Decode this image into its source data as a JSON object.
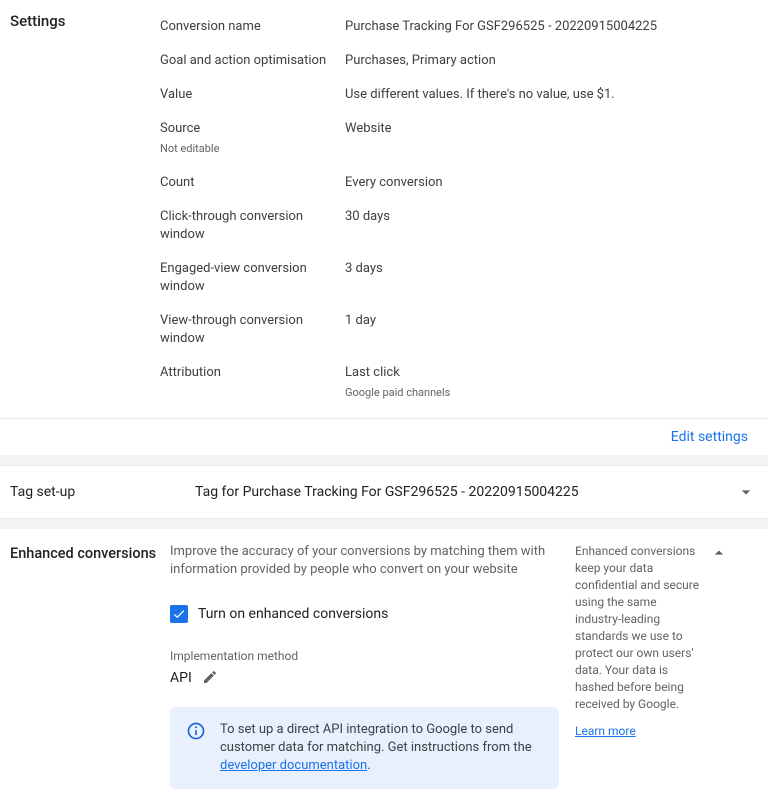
{
  "settings": {
    "heading": "Settings",
    "rows": [
      {
        "label": "Conversion name",
        "sublabel": "",
        "value": "Purchase Tracking For GSF296525 - 20220915004225",
        "subvalue": ""
      },
      {
        "label": "Goal and action optimisation",
        "sublabel": "",
        "value": "Purchases, Primary action",
        "subvalue": ""
      },
      {
        "label": "Value",
        "sublabel": "",
        "value": "Use different values. If there's no value, use $1.",
        "subvalue": ""
      },
      {
        "label": "Source",
        "sublabel": "Not editable",
        "value": "Website",
        "subvalue": ""
      },
      {
        "label": "Count",
        "sublabel": "",
        "value": "Every conversion",
        "subvalue": ""
      },
      {
        "label": "Click-through conversion window",
        "sublabel": "",
        "value": "30 days",
        "subvalue": ""
      },
      {
        "label": "Engaged-view conversion window",
        "sublabel": "",
        "value": "3 days",
        "subvalue": ""
      },
      {
        "label": "View-through conversion window",
        "sublabel": "",
        "value": "1 day",
        "subvalue": ""
      },
      {
        "label": "Attribution",
        "sublabel": "",
        "value": "Last click",
        "subvalue": "Google paid channels"
      }
    ],
    "edit_label": "Edit settings"
  },
  "tag": {
    "heading": "Tag set-up",
    "title": "Tag for Purchase Tracking For GSF296525 - 20220915004225"
  },
  "enhanced": {
    "heading": "Enhanced conversions",
    "description": "Improve the accuracy of your conversions by matching them with information provided by people who convert on your website",
    "checkbox_label": "Turn on enhanced conversions",
    "impl_label": "Implementation method",
    "impl_value": "API",
    "info_text_pre": "To set up a direct API integration to Google to send customer data for matching. Get instructions from the ",
    "info_link": "developer documentation",
    "info_text_post": ".",
    "side_text": "Enhanced conversions keep your data confidential and secure using the same industry-leading standards we use to protect our own users' data. Your data is hashed before being received by Google.",
    "learn_more": "Learn more"
  }
}
